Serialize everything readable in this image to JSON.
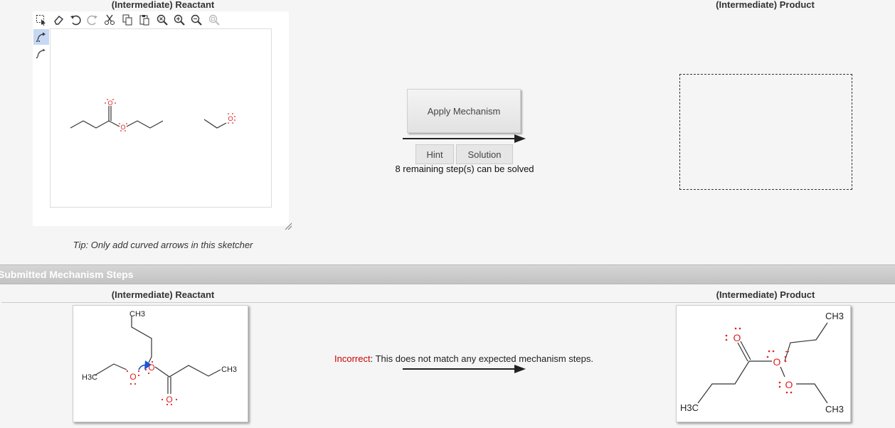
{
  "top": {
    "reactant_title": "(Intermediate) Reactant",
    "product_title": "(Intermediate) Product",
    "tip": "Tip: Only add curved arrows in this sketcher",
    "apply_label": "Apply Mechanism",
    "hint_label": "Hint",
    "solution_label": "Solution",
    "remaining": "8 remaining step(s) can be solved"
  },
  "toolbar": {
    "icons": [
      "select-icon",
      "eraser-icon",
      "undo-icon",
      "redo-icon",
      "cut-icon",
      "copy-icon",
      "paste-icon",
      "zoom-reset-icon",
      "zoom-in-icon",
      "zoom-out-icon",
      "zoom-fit-icon"
    ],
    "left_tools": [
      "curved-arrow-electron-pair-icon",
      "curved-arrow-single-electron-icon"
    ],
    "active_color": "#c6d8f3"
  },
  "section": {
    "title": "Submitted Mechanism Steps"
  },
  "submitted": {
    "reactant_title": "(Intermediate) Reactant",
    "product_title": "(Intermediate) Product",
    "status_word": "Incorrect",
    "status_message": ": This does not match any expected mechanism steps.",
    "status_color": "#cc0000"
  },
  "molecules": {
    "reactant_ch3": "CH3",
    "reactant_h3c": "H3C",
    "product_ch3_top": "CH3",
    "product_h3c": "H3C",
    "product_ch3_bottom": "CH3",
    "oxygen": "O",
    "atom_color": "#e0201e"
  }
}
